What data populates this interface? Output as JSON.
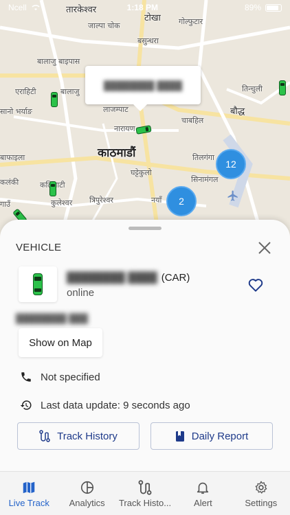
{
  "status_bar": {
    "carrier": "Ncell",
    "time": "1:18 PM",
    "battery": "89%"
  },
  "map": {
    "labels": [
      {
        "text": "तारकेश्वर"
      },
      {
        "text": "टोखा"
      },
      {
        "text": "जाल्पा चोक"
      },
      {
        "text": "गोल्फुटार"
      },
      {
        "text": "बसुन्धरा"
      },
      {
        "text": "बालाजु बाइपास"
      },
      {
        "text": "एराहिटी"
      },
      {
        "text": "बालाजु"
      },
      {
        "text": "तिन्चुली"
      },
      {
        "text": "सानो भर्याङ"
      },
      {
        "text": "लाजम्पाट"
      },
      {
        "text": "बौद्ध"
      },
      {
        "text": "नारायण"
      },
      {
        "text": "चाबहिल"
      },
      {
        "text": "काठमाडौं"
      },
      {
        "text": "तिलगंगा"
      },
      {
        "text": "घट्टेकुलो"
      },
      {
        "text": "सिनामंगल"
      },
      {
        "text": "बाफाइला"
      },
      {
        "text": "कलंकी"
      },
      {
        "text": "कलिमाटी"
      },
      {
        "text": "कुलेश्वर"
      },
      {
        "text": "त्रिपुरेश्वर"
      },
      {
        "text": "गाउँ"
      },
      {
        "text": "नयाँ"
      }
    ],
    "clusters": [
      {
        "count": "12"
      },
      {
        "count": "2"
      }
    ]
  },
  "sheet": {
    "title": "VEHICLE",
    "vehicle_type": "(CAR)",
    "vehicle_status": "online",
    "show_map_label": "Show on Map",
    "phone_text": "Not specified",
    "last_update_text": "Last data update: 9 seconds ago",
    "track_history_label": "Track History",
    "daily_report_label": "Daily Report"
  },
  "tabs": [
    {
      "label": "Live Track",
      "icon": "map-icon",
      "active": true
    },
    {
      "label": "Analytics",
      "icon": "analytics-icon",
      "active": false
    },
    {
      "label": "Track Histo...",
      "icon": "route-icon",
      "active": false
    },
    {
      "label": "Alert",
      "icon": "bell-icon",
      "active": false
    },
    {
      "label": "Settings",
      "icon": "gear-icon",
      "active": false
    }
  ],
  "colors": {
    "accent": "#2463c9",
    "cluster": "#2f8fe0",
    "vehicle": "#2cc24a",
    "button_text": "#1e3a8a"
  }
}
